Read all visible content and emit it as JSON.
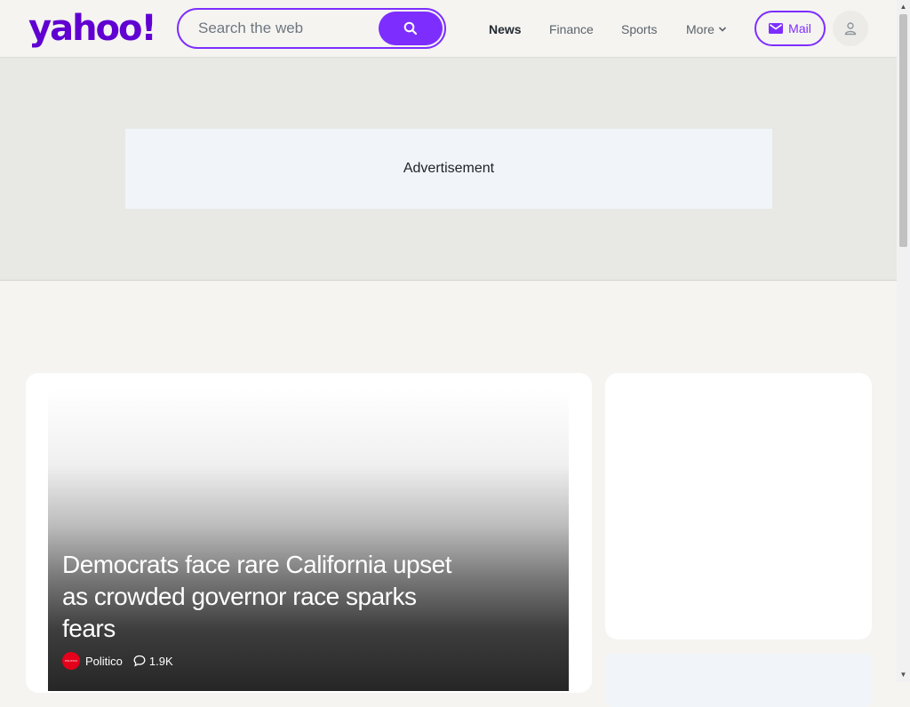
{
  "header": {
    "logo_text": "yahoo!",
    "search_placeholder": "Search the web",
    "search_icon": "search-icon",
    "nav": [
      "News",
      "Finance",
      "Sports",
      "More"
    ],
    "active_nav": "News",
    "mail_label": "Mail",
    "accent_color": "#7d2eff"
  },
  "ad": {
    "label": "Advertisement"
  },
  "hero": {
    "title": "Democrats face rare California upset as crowded governor race sparks fears",
    "source": "Politico",
    "source_logo_text": "POLITICO",
    "comments": "1.9K"
  }
}
